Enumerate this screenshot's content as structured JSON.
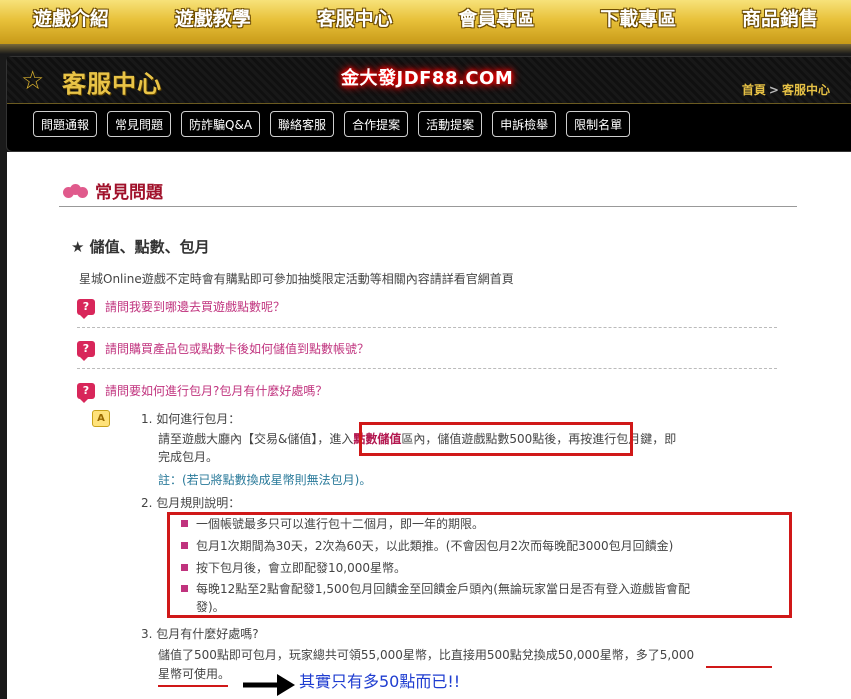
{
  "topnav": [
    "遊戲介紹",
    "遊戲教學",
    "客服中心",
    "會員專區",
    "下載專區",
    "商品銷售"
  ],
  "header": {
    "section_title": "客服中心",
    "watermark": "金大發JDF88.COM",
    "breadcrumb_home": "首頁",
    "breadcrumb_sep": ">",
    "breadcrumb_current": "客服中心"
  },
  "subnav": [
    "問題通報",
    "常見問題",
    "防詐騙Q&A",
    "聯絡客服",
    "合作提案",
    "活動提案",
    "申訴檢舉",
    "限制名單"
  ],
  "content": {
    "faq_title": "常見問題",
    "category": "儲值、點數、包月",
    "intro": "星城Online遊戲不定時會有購點即可參加抽獎限定活動等相關內容請詳看官網首頁",
    "questions": [
      "請問我要到哪邊去買遊戲點數呢？",
      "請問購買產品包或點數卡後如何儲值到點數帳號？",
      "請問要如何進行包月?包月有什麼好處嗎？"
    ],
    "answer_icon": "A",
    "answer": {
      "s1_title": "1. 如何進行包月：",
      "s1_line1a": "請至遊戲大廳內【交易&儲值】，",
      "s1_line1b": "進入",
      "s1_line1_pink": "點數儲值",
      "s1_line1c": "區內，儲值遊戲點數500點後",
      "s1_line1d": "，再按進行包月鍵，即",
      "s1_line2": "完成包月。",
      "s1_note": "註：(若已將點數換成星幣則無法包月)。",
      "s2_title": "2. 包月規則說明：",
      "rules": [
        "一個帳號最多只可以進行包十二個月，即一年的期限。",
        "包月1次期間為30天，2次為60天，以此類推。(不會因包月2次而每晚配3000包月回饋金)",
        "按下包月後，會立即配發10,000星幣。",
        "每晚12點至2點會配發1,500包月回饋金至回饋金戶頭內(無論玩家當日是否有登入遊戲皆會配",
        "發)。"
      ],
      "s3_title": "3. 包月有什麼好處嗎?",
      "s3_line1": "儲值了500點即可包月，玩家總共可領55,000星幣，比直接用500點兌換成50,000星幣，",
      "s3_line1_tail": "多了5,000",
      "s3_line2": "星幣可使用",
      "s3_line2_tail": "。"
    },
    "annotation": "其實只有多50點而已!!"
  },
  "colors": {
    "gold": "#e8c13a",
    "accent_pink": "#c0337e",
    "annotation_red": "#d01818",
    "annotation_blue": "#1f3dd0"
  }
}
